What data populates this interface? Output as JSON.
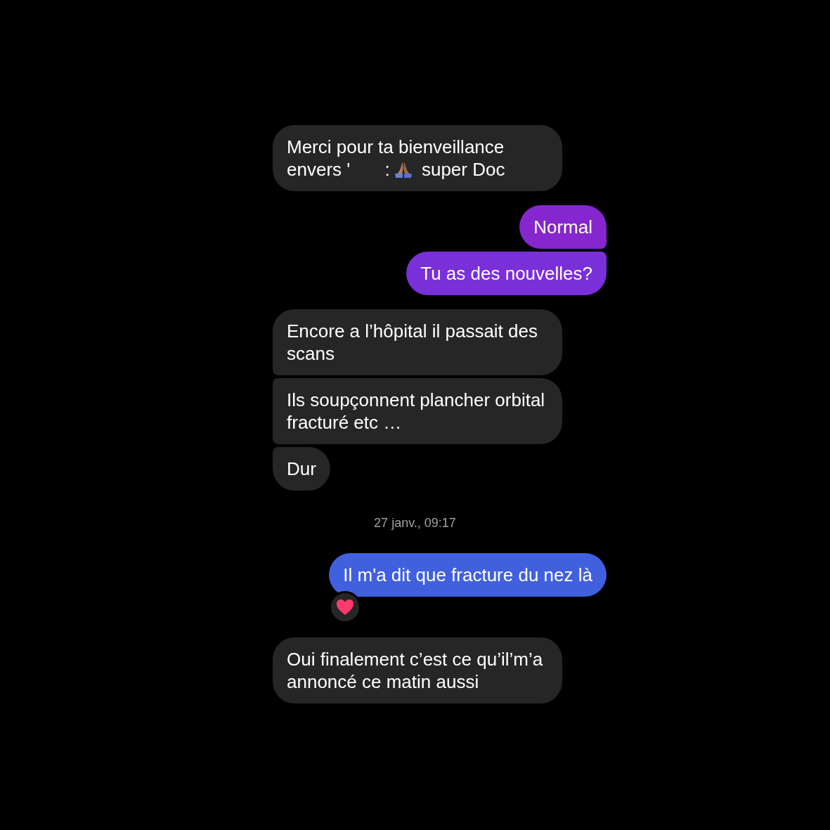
{
  "conversation": [
    {
      "kind": "message",
      "sent": false,
      "segments": [
        {
          "kind": "text",
          "text": "Merci pour ta bienveillance envers '"
        },
        {
          "kind": "redacted"
        },
        {
          "kind": "text",
          "text": ":"
        },
        {
          "kind": "pray_emoji"
        },
        {
          "kind": "text",
          "text": "super Doc"
        }
      ]
    },
    {
      "kind": "message",
      "sent": true,
      "color": "#8626cf",
      "segments": [
        {
          "kind": "text",
          "text": "Normal"
        }
      ]
    },
    {
      "kind": "message",
      "sent": true,
      "color": "#7a30d8",
      "segments": [
        {
          "kind": "text",
          "text": "Tu as des nouvelles?"
        }
      ]
    },
    {
      "kind": "message",
      "sent": false,
      "segments": [
        {
          "kind": "text",
          "text": "Encore a l’hôpital il passait des scans"
        }
      ]
    },
    {
      "kind": "message",
      "sent": false,
      "segments": [
        {
          "kind": "text",
          "text": "Ils soupçonnent plancher orbital fracturé etc …"
        }
      ]
    },
    {
      "kind": "message",
      "sent": false,
      "segments": [
        {
          "kind": "text",
          "text": "Dur"
        }
      ]
    },
    {
      "kind": "timestamp",
      "text": "27 janv., 09:17"
    },
    {
      "kind": "message",
      "sent": true,
      "color": "#4160df",
      "hearted": true,
      "segments": [
        {
          "kind": "text",
          "text": "Il m'a dit que fracture du nez là"
        }
      ]
    },
    {
      "kind": "message",
      "sent": false,
      "segments": [
        {
          "kind": "text",
          "text": "Oui finalement c’est ce qu’il’m’a annoncé ce matin aussi"
        }
      ]
    }
  ]
}
